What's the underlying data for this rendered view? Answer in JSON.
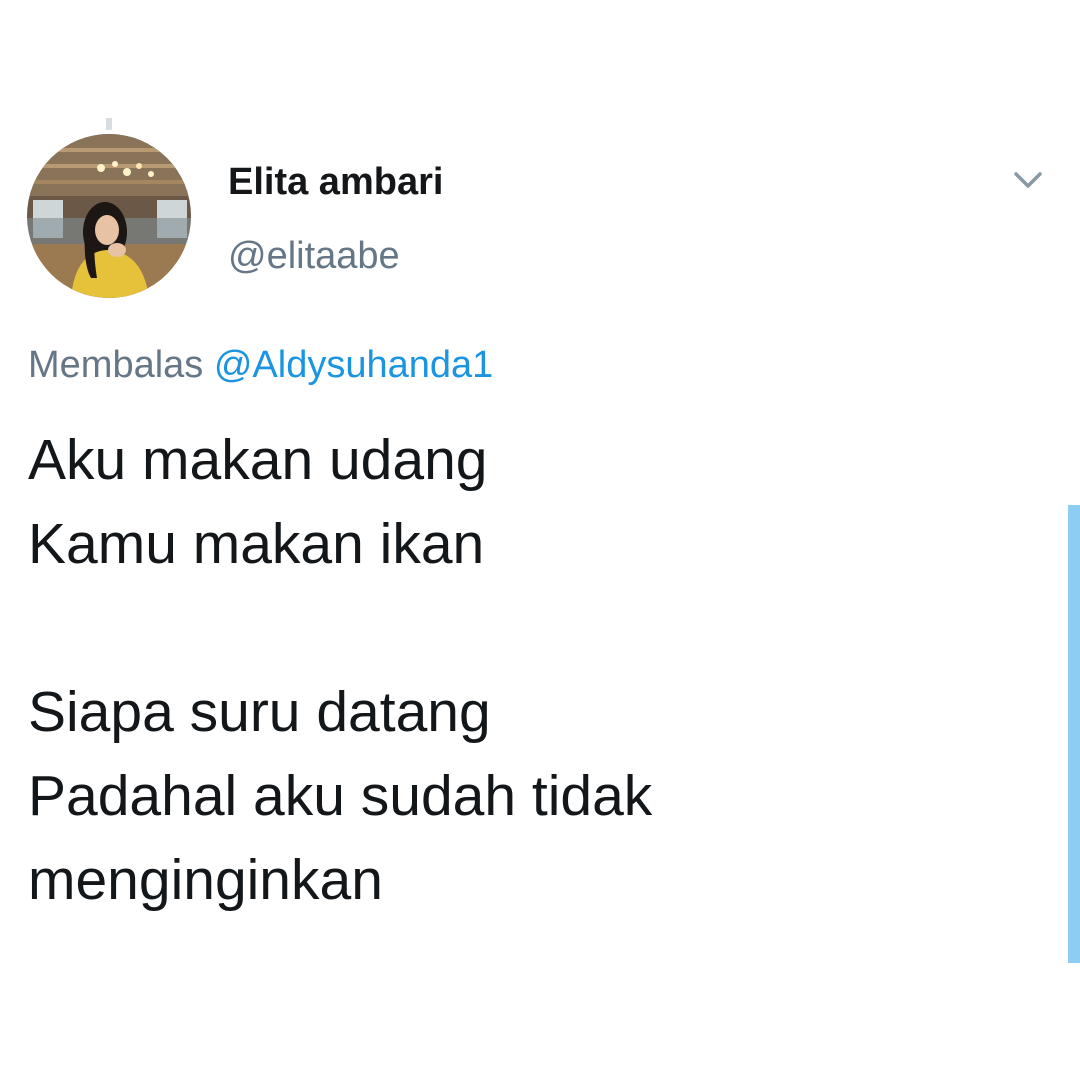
{
  "tweet": {
    "author": {
      "display_name": "Elita ambari",
      "username": "@elitaabe"
    },
    "reply": {
      "prefix": "Membalas ",
      "mention": "@Aldysuhanda1"
    },
    "lines": [
      "Aku makan udang",
      "Kamu makan ikan",
      "",
      "Siapa suru datang",
      "Padahal aku sudah tidak",
      "menginginkan"
    ],
    "menu_icon": "chevron-down-icon"
  },
  "colors": {
    "text_primary": "#14171a",
    "text_secondary": "#657786",
    "link": "#1b95e0",
    "scroll_indicator": "#8ecdf3"
  }
}
